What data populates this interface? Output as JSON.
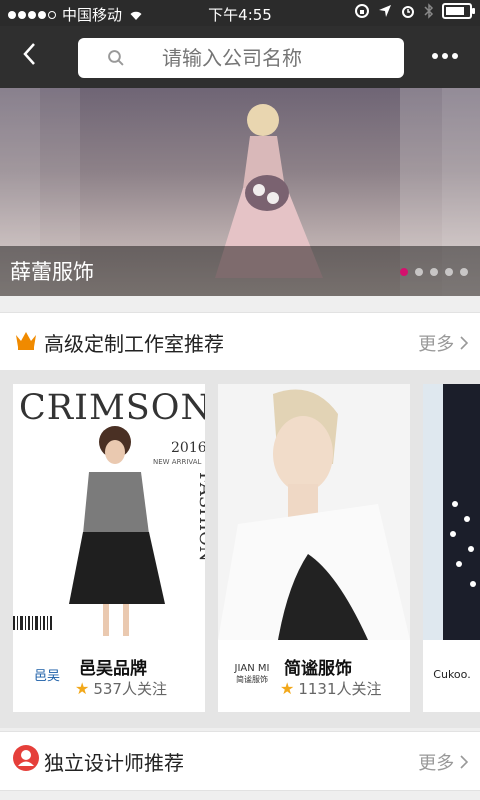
{
  "status_bar": {
    "carrier": "中国移动",
    "time": "下午4:55"
  },
  "header": {
    "search_placeholder": "请输入公司名称"
  },
  "banner": {
    "caption": "薛蕾服饰",
    "dot_count": 5,
    "active_index": 0,
    "accent_color": "#d4116e"
  },
  "section_studio": {
    "title": "高级定制工作室推荐",
    "more": "更多",
    "icon": "crown-icon",
    "icon_color": "#f08a00"
  },
  "cards": [
    {
      "img_title": "CRIMSON",
      "img_year": "2016",
      "img_sub": "NEW ARRIVAL",
      "img_side": "FASHION",
      "logo_text": "邑吴",
      "name": "邑吴品牌",
      "followers": "537人关注"
    },
    {
      "logo_text": "JIAN MI",
      "logo_sub": "简谧服饰",
      "name": "简谧服饰",
      "followers": "1131人关注"
    },
    {
      "logo_text": "Cukoo."
    }
  ],
  "section_designer": {
    "title": "独立设计师推荐",
    "more": "更多",
    "icon": "designer-icon",
    "icon_color": "#e53f3a"
  }
}
